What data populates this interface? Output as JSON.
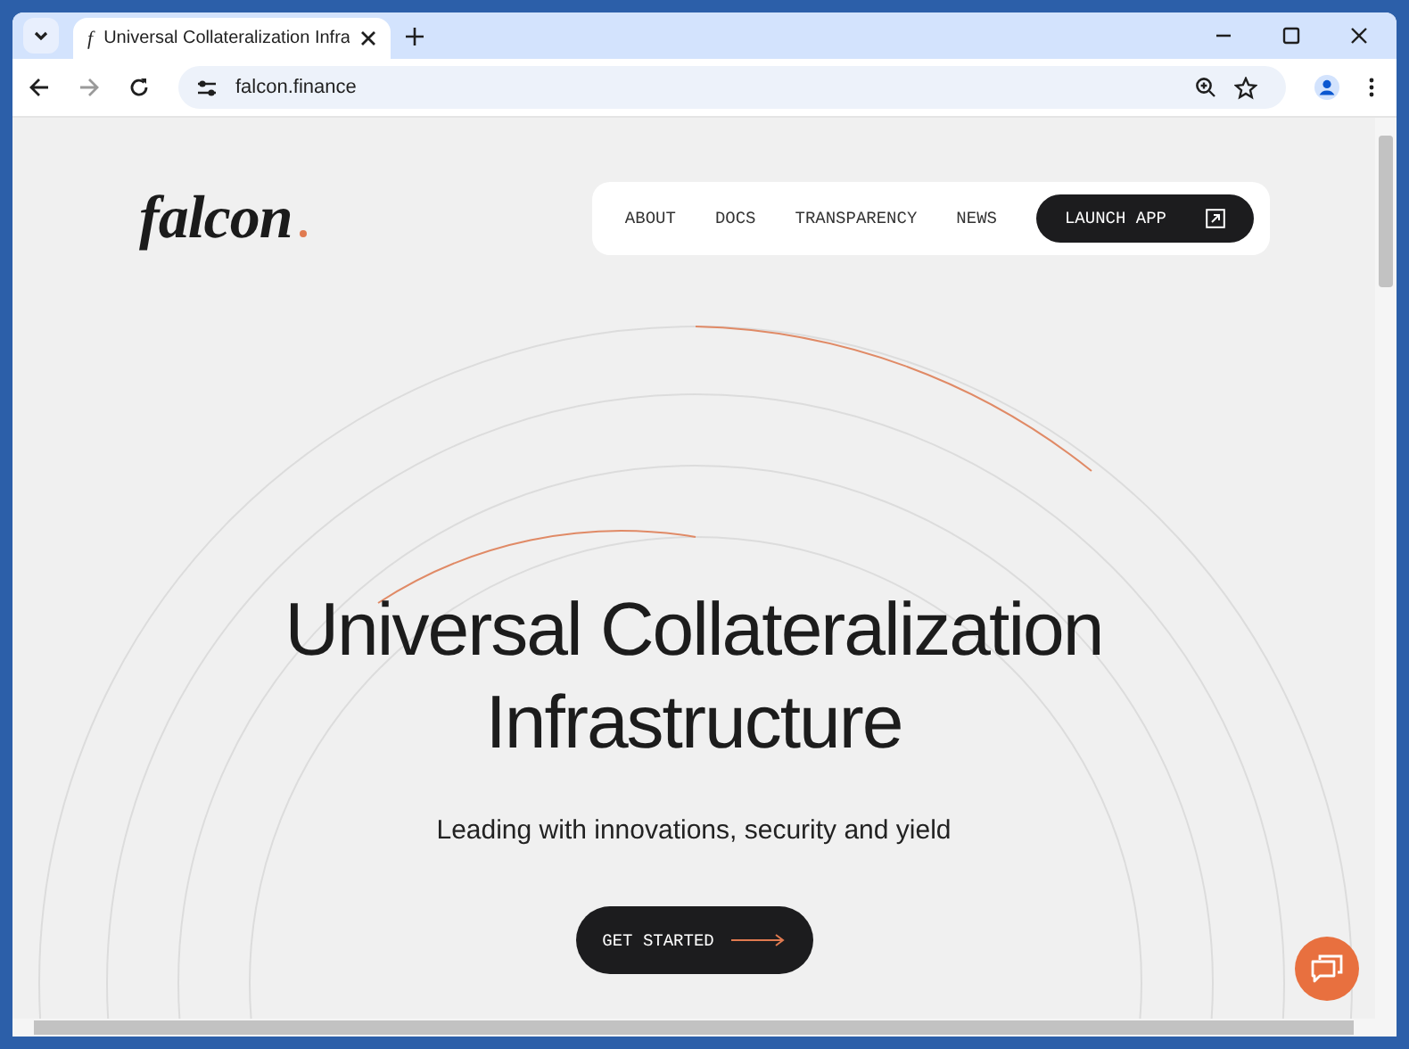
{
  "browser": {
    "tab": {
      "favicon": "f",
      "title": "Universal Collateralization Infra"
    },
    "address": "falcon.finance"
  },
  "header": {
    "logo": "falcon",
    "nav": [
      {
        "label": "ABOUT"
      },
      {
        "label": "DOCS"
      },
      {
        "label": "TRANSPARENCY"
      },
      {
        "label": "NEWS"
      }
    ],
    "cta": "LAUNCH APP"
  },
  "hero": {
    "title_lines": [
      "Universal Collateralization",
      "Infrastructure"
    ],
    "subtitle": "Leading with innovations, security and yield",
    "button": "GET STARTED"
  }
}
